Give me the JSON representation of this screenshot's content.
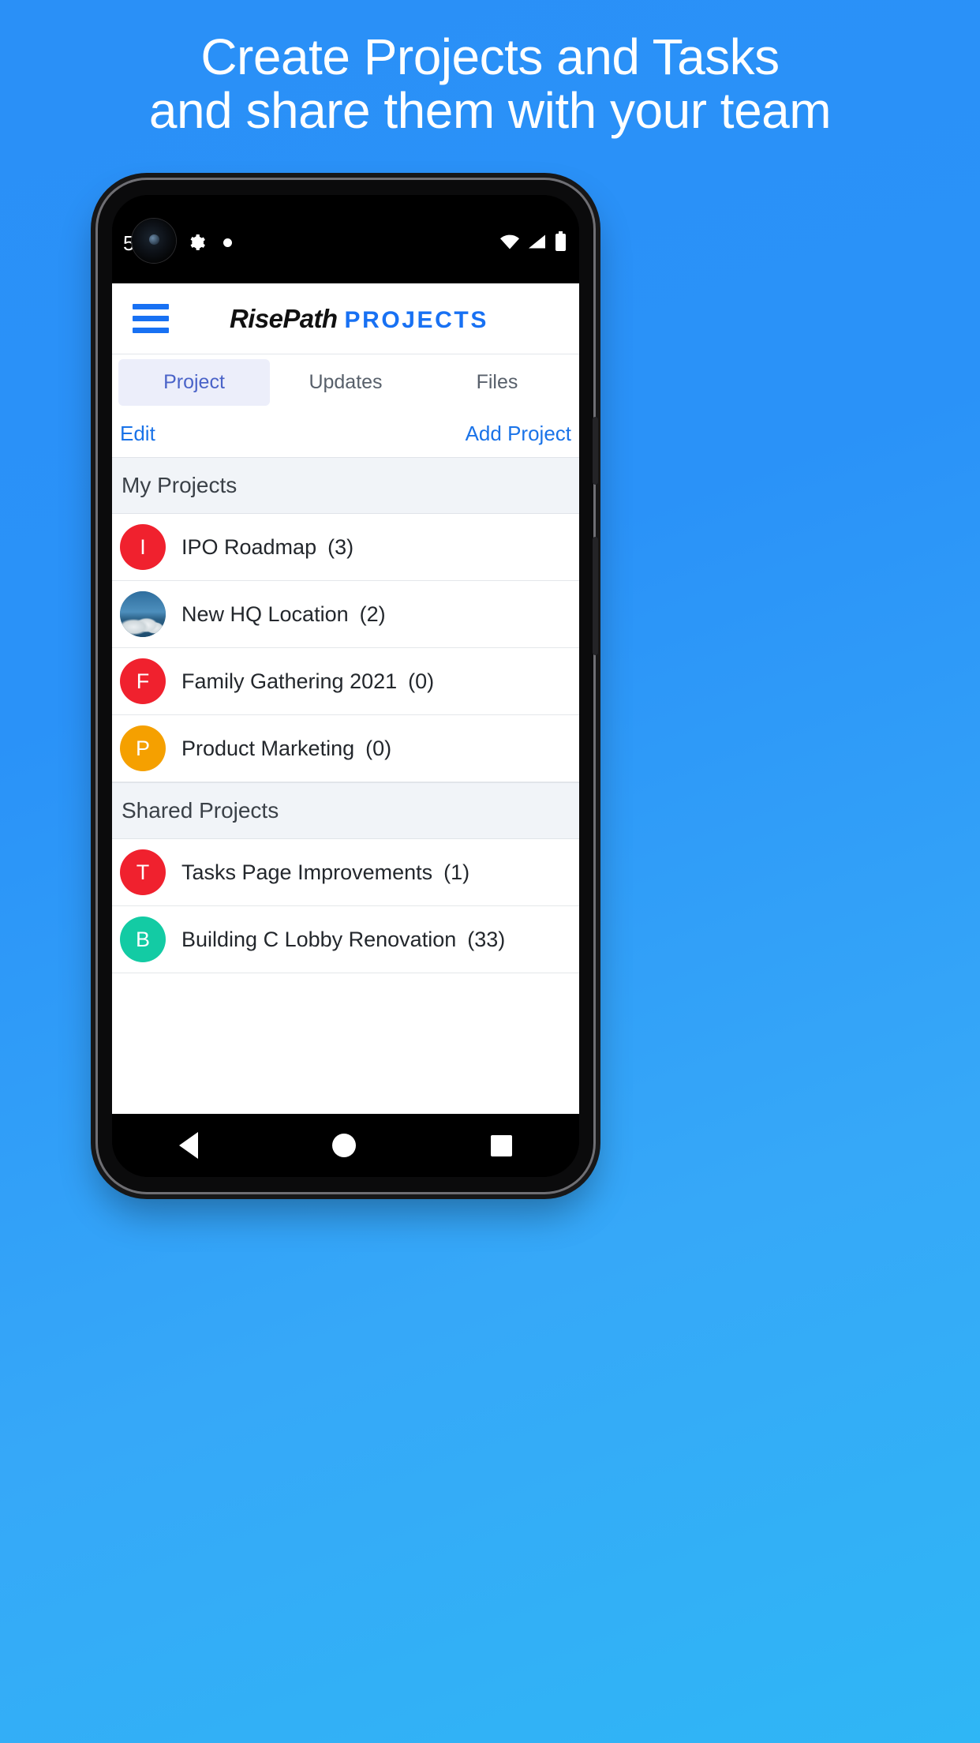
{
  "headline": {
    "line1": "Create Projects and Tasks",
    "line2": "and share them with your team"
  },
  "theme": {
    "background_blue": "#2a90f7",
    "accent_blue": "#1871f3",
    "link_blue": "#1a73e8",
    "tab_active_bg": "#eceefa",
    "tab_active_text": "#4a63c8",
    "section_bg": "#f1f4f8"
  },
  "statusbar": {
    "left_digit": "5",
    "icons_left": [
      "gear-icon",
      "dot-icon"
    ],
    "icons_right": [
      "wifi-icon",
      "signal-icon",
      "battery-icon"
    ]
  },
  "appbar": {
    "menu_icon": "hamburger-menu-icon",
    "logo_primary": "RisePath",
    "logo_secondary": "PROJECTS"
  },
  "tabs": [
    {
      "label": "Project",
      "active": true
    },
    {
      "label": "Updates",
      "active": false
    },
    {
      "label": "Files",
      "active": false
    }
  ],
  "actions": {
    "edit_label": "Edit",
    "add_label": "Add Project"
  },
  "sections": [
    {
      "title": "My Projects",
      "items": [
        {
          "title": "IPO Roadmap",
          "count": "(3)",
          "avatar_letter": "I",
          "avatar_color": "#f0212e",
          "avatar_type": "letter"
        },
        {
          "title": "New HQ Location",
          "count": "(2)",
          "avatar_letter": "",
          "avatar_color": "#3b6c8f",
          "avatar_type": "photo"
        },
        {
          "title": "Family Gathering 2021",
          "count": "(0)",
          "avatar_letter": "F",
          "avatar_color": "#f0212e",
          "avatar_type": "letter"
        },
        {
          "title": "Product Marketing",
          "count": "(0)",
          "avatar_letter": "P",
          "avatar_color": "#f5a000",
          "avatar_type": "letter"
        }
      ]
    },
    {
      "title": "Shared Projects",
      "items": [
        {
          "title": "Tasks Page Improvements",
          "count": "(1)",
          "avatar_letter": "T",
          "avatar_color": "#f0212e",
          "avatar_type": "letter"
        },
        {
          "title": "Building C Lobby Renovation",
          "count": "(33)",
          "avatar_letter": "B",
          "avatar_color": "#13cba4",
          "avatar_type": "letter"
        }
      ]
    }
  ],
  "navbar": {
    "back": "back-triangle-icon",
    "home": "home-circle-icon",
    "recent": "recent-square-icon"
  }
}
